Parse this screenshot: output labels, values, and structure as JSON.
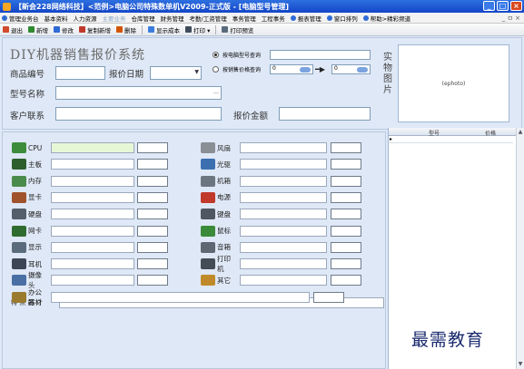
{
  "window": {
    "title": "【新会228网络科技】<范例>电脑公司特殊数单机V2009-正式版 - [电脑型号管理]",
    "controls": [
      "_",
      "□",
      "×"
    ]
  },
  "menubar": {
    "items": [
      {
        "label": "管理业务台",
        "muted": false
      },
      {
        "label": "基本资料",
        "muted": false
      },
      {
        "label": "人力资源",
        "muted": false
      },
      {
        "label": "主要业务",
        "muted": true
      },
      {
        "label": "仓库管理",
        "muted": false
      },
      {
        "label": "财务管理",
        "muted": false
      },
      {
        "label": "考勤/工资管理",
        "muted": false
      },
      {
        "label": "事务管理",
        "muted": false
      },
      {
        "label": "工程事务",
        "muted": false
      },
      {
        "label": "报表管理",
        "muted": false
      },
      {
        "label": "窗口排列",
        "muted": false
      },
      {
        "label": "帮助>精彩频道",
        "muted": false
      }
    ],
    "right": "_ ㅁ ×"
  },
  "toolbar": {
    "items": [
      {
        "label": "退出",
        "color": "#d14a2c"
      },
      {
        "label": "新增",
        "color": "#2f8a2f"
      },
      {
        "label": "修改",
        "color": "#2f6bd6"
      },
      {
        "label": "复制新增",
        "color": "#c0392b"
      },
      {
        "label": "删除",
        "color": "#d35400"
      },
      {
        "label": "显示成本",
        "color": "#3b7ddd"
      },
      {
        "label": "打印 ▾",
        "color": "#3f4b5b"
      },
      {
        "label": "打印预览",
        "color": "#5a6b7c"
      }
    ]
  },
  "form": {
    "title": "DIY机器销售报价系统",
    "product_code_label": "商品编号",
    "product_code_value": "",
    "quote_date_label": "报价日期",
    "quote_date_value": "",
    "model_name_label": "型号名称",
    "model_name_value": "",
    "customer_label": "客户联系",
    "customer_value": "",
    "quote_amount_label": "报价金额",
    "quote_amount_value": "",
    "query_by_model_label": "按电脑型号查询",
    "query_by_model_value": "",
    "query_by_price_label": "按销售价格查询",
    "price_from": "0",
    "price_to": "0",
    "photo_label": "实物图片",
    "photo_placeholder": "(ephoto)"
  },
  "parts_left": [
    {
      "label": "CPU",
      "icon_color": "#3c8c3c",
      "value": "",
      "price": "",
      "highlight": true
    },
    {
      "label": "主板",
      "icon_color": "#2d5f2d",
      "value": "",
      "price": "",
      "highlight": false
    },
    {
      "label": "内存",
      "icon_color": "#4a8a4a",
      "value": "",
      "price": "",
      "highlight": false
    },
    {
      "label": "显卡",
      "icon_color": "#a0522d",
      "value": "",
      "price": "",
      "highlight": false
    },
    {
      "label": "硬盘",
      "icon_color": "#555f6b",
      "value": "",
      "price": "",
      "highlight": false
    },
    {
      "label": "网卡",
      "icon_color": "#2f6a2f",
      "value": "",
      "price": "",
      "highlight": false
    },
    {
      "label": "显示",
      "icon_color": "#5a6b7c",
      "value": "",
      "price": "",
      "highlight": false
    },
    {
      "label": "耳机",
      "icon_color": "#3d4654",
      "value": "",
      "price": "",
      "highlight": false
    },
    {
      "label": "摄像头",
      "icon_color": "#4a6fa5",
      "value": "",
      "price": "",
      "highlight": false
    },
    {
      "label": "办公器材",
      "icon_color": "#9a7b2e",
      "value": "",
      "price": "",
      "highlight": false
    }
  ],
  "parts_right": [
    {
      "label": "风扇",
      "icon_color": "#8a8f96",
      "value": "",
      "price": ""
    },
    {
      "label": "光驱",
      "icon_color": "#3b6fb0",
      "value": "",
      "price": ""
    },
    {
      "label": "机箱",
      "icon_color": "#6c7681",
      "value": "",
      "price": ""
    },
    {
      "label": "电源",
      "icon_color": "#c0392b",
      "value": "",
      "price": ""
    },
    {
      "label": "键盘",
      "icon_color": "#4e5762",
      "value": "",
      "price": ""
    },
    {
      "label": "鼠标",
      "icon_color": "#3a8a3a",
      "value": "",
      "price": ""
    },
    {
      "label": "音箱",
      "icon_color": "#5f6872",
      "value": "",
      "price": ""
    },
    {
      "label": "打印机",
      "icon_color": "#444c55",
      "value": "",
      "price": ""
    },
    {
      "label": "其它",
      "icon_color": "#c08a2a",
      "value": "",
      "price": ""
    }
  ],
  "features_label": "特 点 简 介",
  "features_value": "",
  "grid": {
    "columns": [
      "型号",
      "价格"
    ],
    "row_marker": "▸"
  },
  "watermark": "最需教育"
}
